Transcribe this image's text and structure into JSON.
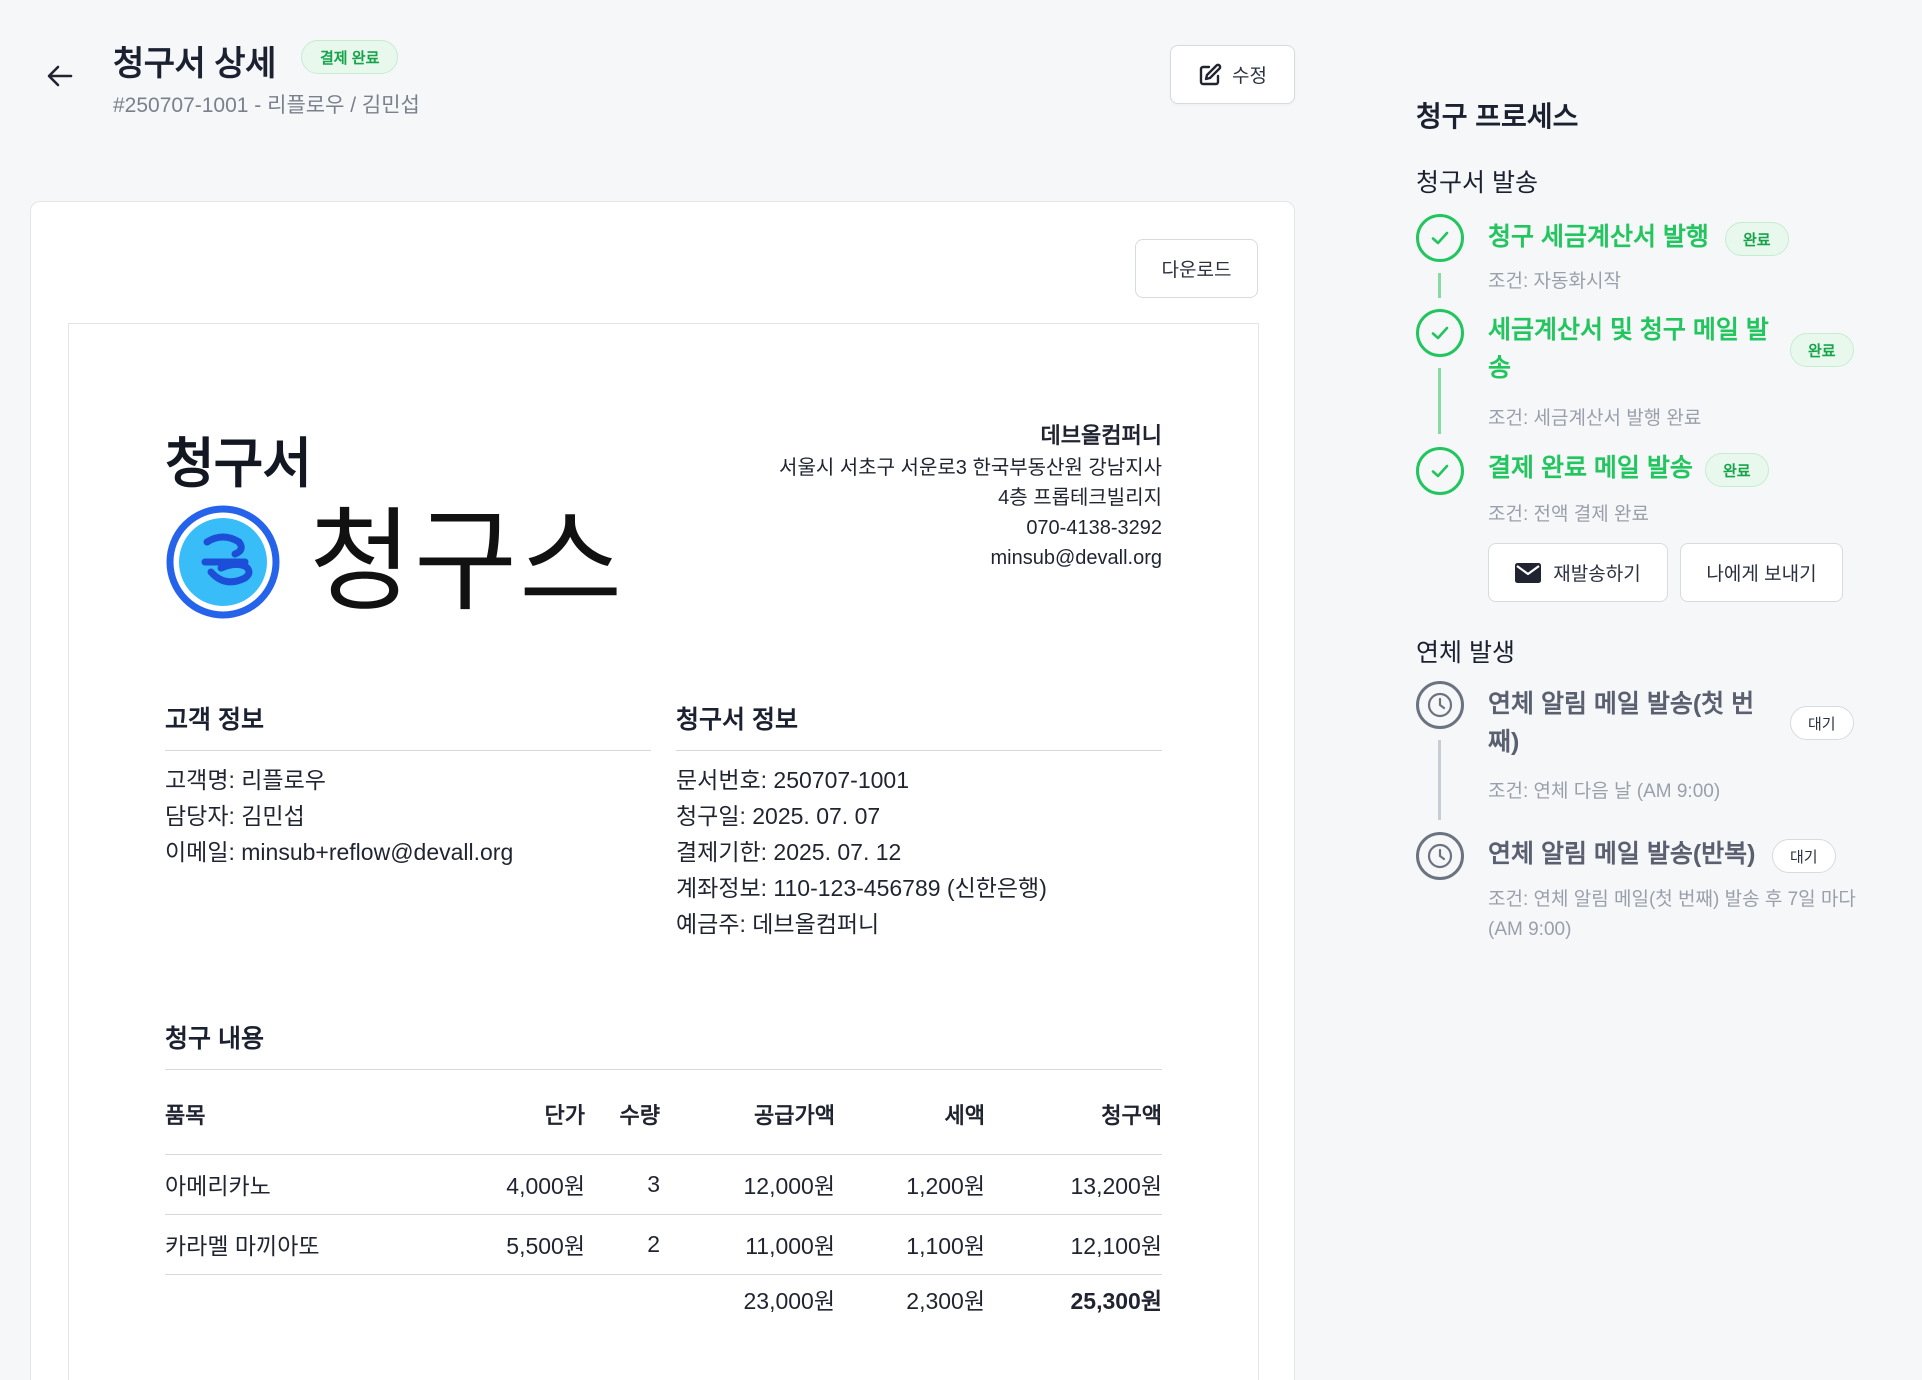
{
  "header": {
    "title": "청구서 상세",
    "status_badge": "결제 완료",
    "subtitle": "#250707-1001 - 리플로우 / 김민섭",
    "edit_label": "수정"
  },
  "card": {
    "download_label": "다운로드"
  },
  "invoice": {
    "title": "청구서",
    "logo_text": "청구스",
    "company": {
      "name": "데브올컴퍼니",
      "address1": "서울시 서초구 서운로3 한국부동산원 강남지사",
      "address2": "4층 프롭테크빌리지",
      "phone": "070-4138-3292",
      "email": "minsub@devall.org"
    },
    "customer": {
      "heading": "고객 정보",
      "name": "고객명: 리플로우",
      "manager": "담당자: 김민섭",
      "email": "이메일: minsub+reflow@devall.org"
    },
    "info": {
      "heading": "청구서 정보",
      "doc_no": "문서번호: 250707-1001",
      "issue_date": "청구일: 2025. 07. 07",
      "due_date": "결제기한: 2025. 07. 12",
      "account": "계좌정보: 110-123-456789 (신한은행)",
      "holder": "예금주: 데브올컴퍼니"
    },
    "items": {
      "heading": "청구 내용",
      "columns": [
        "품목",
        "단가",
        "수량",
        "공급가액",
        "세액",
        "청구액"
      ],
      "rows": [
        [
          "아메리카노",
          "4,000원",
          "3",
          "12,000원",
          "1,200원",
          "13,200원"
        ],
        [
          "카라멜 마끼아또",
          "5,500원",
          "2",
          "11,000원",
          "1,100원",
          "12,100원"
        ]
      ],
      "totals": {
        "supply": "23,000원",
        "tax": "2,300원",
        "amount": "25,300원"
      }
    }
  },
  "process": {
    "title": "청구 프로세스",
    "phase1": "청구서 발송",
    "phase2": "연체 발생",
    "steps": [
      {
        "name": "청구 세금계산서 발행",
        "badge": "완료",
        "cond": "조건: 자동화시작"
      },
      {
        "name": "세금계산서 및 청구 메일 발송",
        "badge": "완료",
        "cond": "조건: 세금계산서 발행 완료"
      },
      {
        "name": "결제 완료 메일 발송",
        "badge": "완료",
        "cond": "조건: 전액 결제 완료"
      },
      {
        "name": "연체 알림 메일 발송(첫 번째)",
        "badge": "대기",
        "cond": "조건: 연체 다음 날 (AM 9:00)"
      },
      {
        "name": "연체 알림 메일 발송(반복)",
        "badge": "대기",
        "cond": "조건: 연체 알림 메일(첫 번째) 발송 후 7일 마다 (AM 9:00)"
      }
    ],
    "resend_label": "재발송하기",
    "send_to_me_label": "나에게 보내기"
  },
  "colors": {
    "accent_green": "#22c55e",
    "wait_gray": "#6b7280",
    "logo_blue": "#2563eb",
    "logo_light_blue": "#38bdf8"
  }
}
